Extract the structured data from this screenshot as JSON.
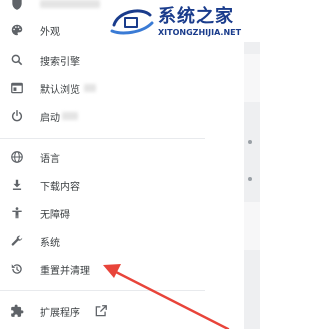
{
  "sidebar": {
    "items": [
      {
        "label": "外观",
        "icon": "palette-icon"
      },
      {
        "label": "搜索引擎",
        "icon": "search-icon"
      },
      {
        "label": "默认浏览",
        "icon": "browser-icon"
      },
      {
        "label": "启动",
        "icon": "power-icon"
      },
      {
        "label": "语言",
        "icon": "globe-icon"
      },
      {
        "label": "下载内容",
        "icon": "download-icon"
      },
      {
        "label": "无障碍",
        "icon": "accessibility-icon"
      },
      {
        "label": "系统",
        "icon": "wrench-icon"
      },
      {
        "label": "重置并清理",
        "icon": "reset-history-icon"
      },
      {
        "label": "扩展程序",
        "icon": "puzzle-icon",
        "trailing_icon": "open-external-icon"
      }
    ]
  },
  "watermark": {
    "title": "系统之家",
    "url": "XITONGZHIJIA.NET",
    "color": "#1a3c8c"
  },
  "annotation": {
    "arrow_color": "#e8443a",
    "points_to": "重置并清理"
  }
}
